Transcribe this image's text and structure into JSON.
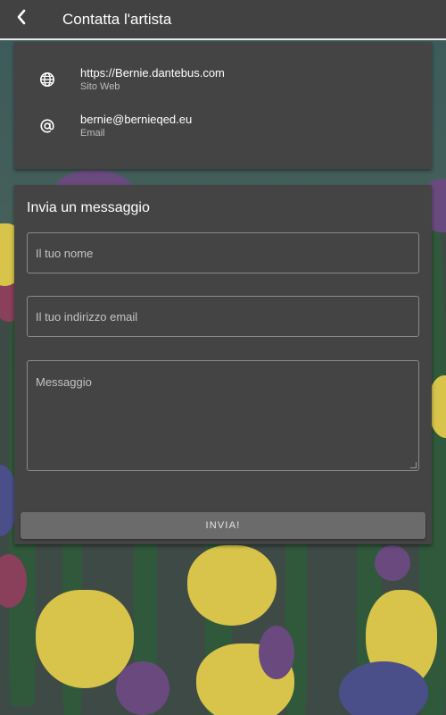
{
  "appbar": {
    "title": "Contatta l'artista",
    "back_icon": "chevron-left-icon"
  },
  "contact": {
    "website": {
      "value": "https://Bernie.dantebus.com",
      "label": "Sito Web",
      "icon": "globe-icon"
    },
    "email": {
      "value": "bernie@bernieqed.eu",
      "label": "Email",
      "icon": "at-icon"
    }
  },
  "form": {
    "title": "Invia un messaggio",
    "name_placeholder": "Il tuo nome",
    "email_placeholder": "Il tuo indirizzo email",
    "message_placeholder": "Messaggio",
    "submit_label": "INVIA!"
  },
  "colors": {
    "appbar": "#424242",
    "card": "#444444",
    "button": "#6b6b6b",
    "text": "#ffffff"
  }
}
